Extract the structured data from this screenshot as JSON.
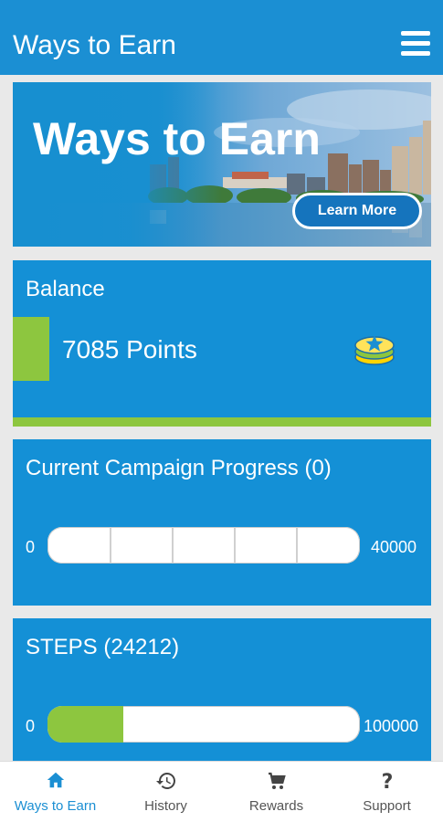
{
  "header": {
    "title": "Ways to Earn",
    "menu_icon": "hamburger-menu-icon"
  },
  "banner": {
    "headline": "Ways to Earn",
    "button_label": "Learn More"
  },
  "balance": {
    "title": "Balance",
    "points_text": "7085 Points",
    "icon": "coin-stack-star-icon"
  },
  "campaign": {
    "title": "Current Campaign Progress (0)",
    "min": "0",
    "max": "40000",
    "progress_fraction": 0
  },
  "steps": {
    "title": "STEPS (24212)",
    "min": "0",
    "max": "100000",
    "progress_fraction": 0.24212
  },
  "nav": {
    "items": [
      {
        "label": "Ways to Earn",
        "icon": "home-icon",
        "active": true
      },
      {
        "label": "History",
        "icon": "history-icon",
        "active": false
      },
      {
        "label": "Rewards",
        "icon": "cart-icon",
        "active": false
      },
      {
        "label": "Support",
        "icon": "question-icon",
        "active": false
      }
    ]
  },
  "colors": {
    "brand_blue": "#1b8fd3",
    "card_blue": "#1490d6",
    "accent_green": "#8dc63f"
  }
}
